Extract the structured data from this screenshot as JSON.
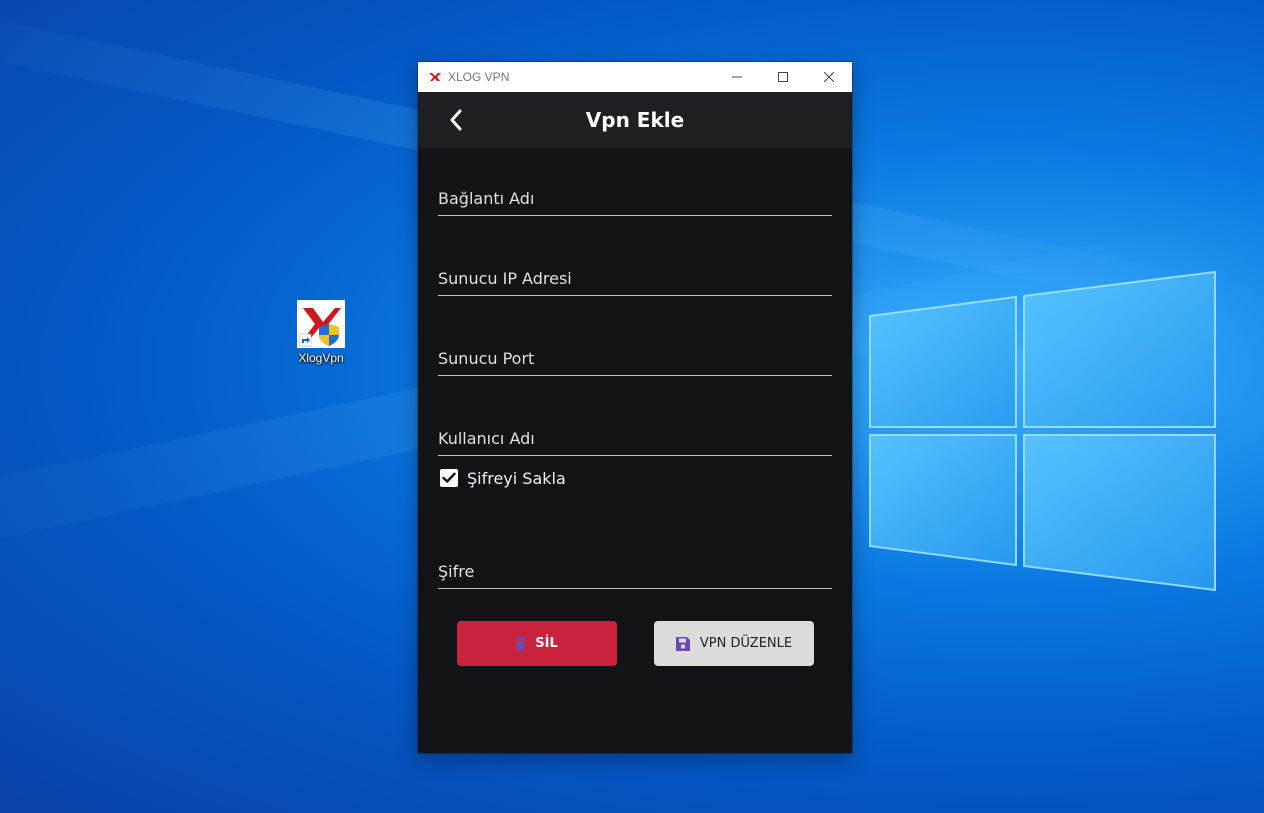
{
  "window": {
    "title": "XLOG VPN"
  },
  "appbar": {
    "title": "Vpn Ekle"
  },
  "form": {
    "connection_name": {
      "placeholder": "Bağlantı Adı",
      "value": ""
    },
    "server_ip": {
      "placeholder": "Sunucu IP Adresi",
      "value": ""
    },
    "server_port": {
      "placeholder": "Sunucu Port",
      "value": ""
    },
    "username": {
      "placeholder": "Kullanıcı Adı",
      "value": ""
    },
    "save_password": {
      "label": "Şifreyi Sakla",
      "checked": true
    },
    "password": {
      "placeholder": "Şifre",
      "value": ""
    }
  },
  "buttons": {
    "delete_label": "SİL",
    "edit_label": "VPN DÜZENLE"
  },
  "desktop": {
    "shortcut_label": "XlogVpn"
  },
  "colors": {
    "accent_red": "#c8223e",
    "edit_button_bg": "#dcdcdc",
    "icon_purple": "#6a4bb0",
    "app_bg": "#121316",
    "appbar_bg": "#1f1f23"
  },
  "icons": {
    "back": "chevron-left-icon",
    "delete": "trash-icon",
    "edit": "floppy-save-icon",
    "checkbox": "check-icon"
  }
}
